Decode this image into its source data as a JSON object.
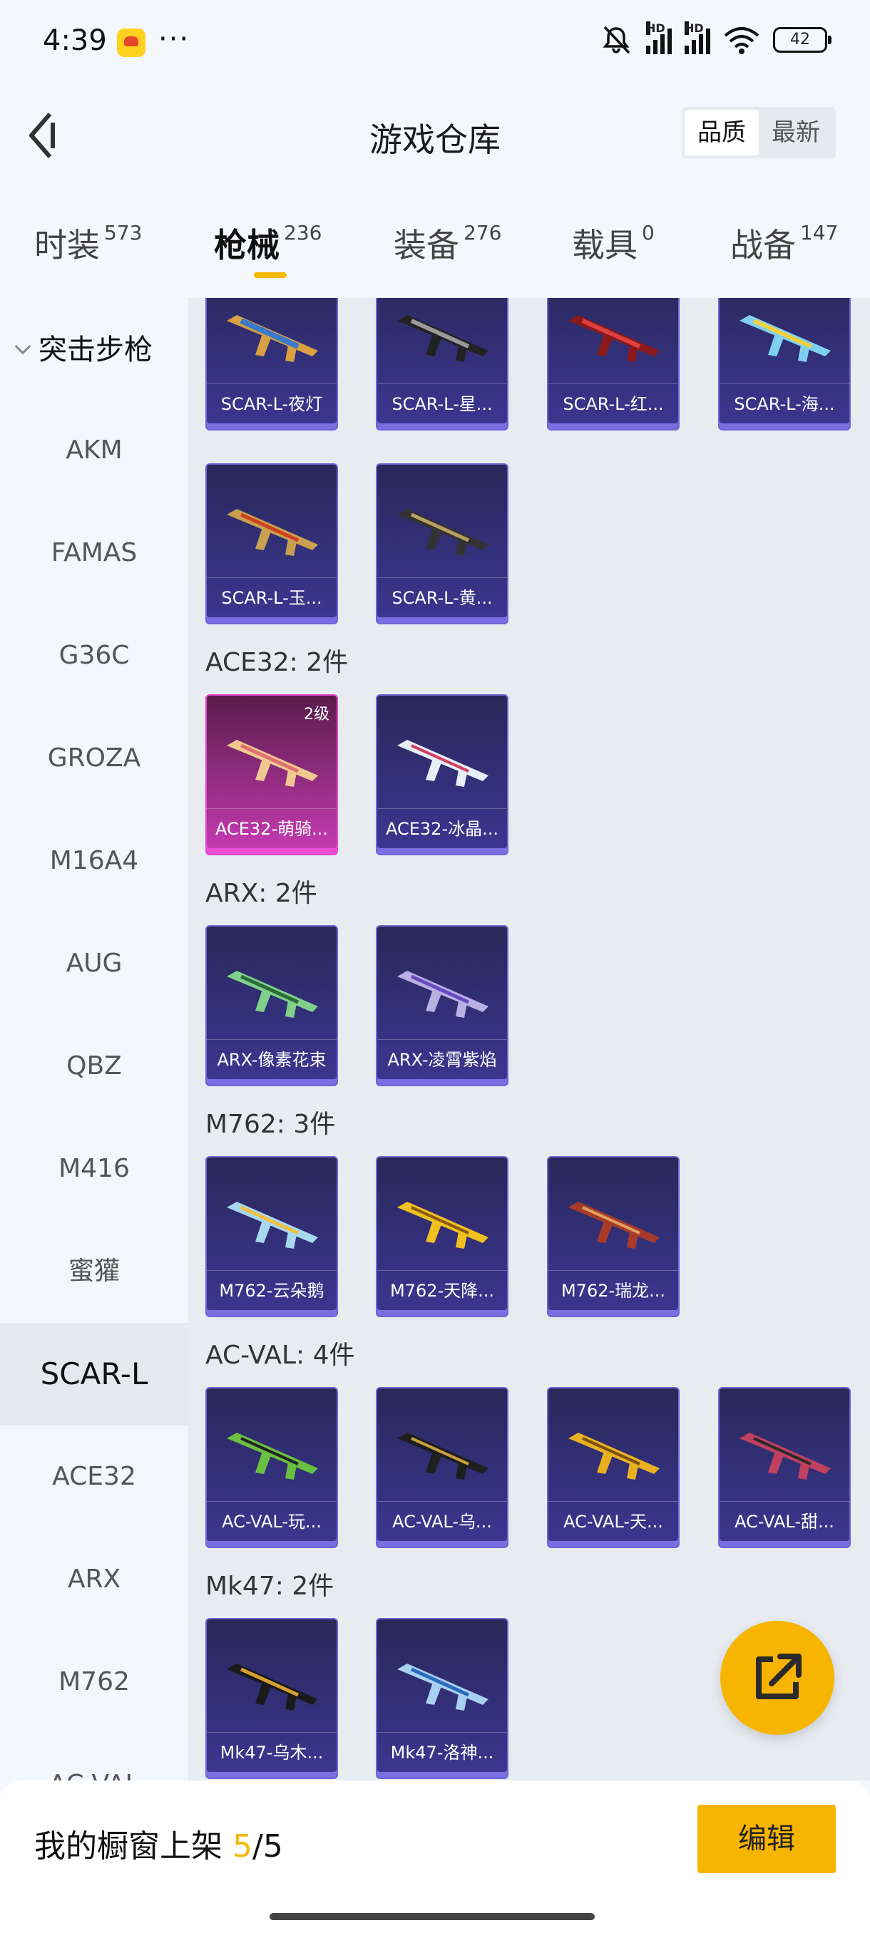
{
  "status_bar": {
    "time": "4:39",
    "dots": "···",
    "battery": "42",
    "signal_1": "HD",
    "signal_2": "HD"
  },
  "header": {
    "title": "游戏仓库",
    "sort_options": [
      "品质",
      "最新"
    ],
    "active_sort": "品质"
  },
  "tabs": [
    {
      "label": "时装",
      "count": "573"
    },
    {
      "label": "枪械",
      "count": "236",
      "active": true
    },
    {
      "label": "装备",
      "count": "276"
    },
    {
      "label": "载具",
      "count": "0"
    },
    {
      "label": "战备",
      "count": "147"
    }
  ],
  "sidebar": {
    "group": "突击步枪",
    "items": [
      "AKM",
      "FAMAS",
      "G36C",
      "GROZA",
      "M16A4",
      "AUG",
      "QBZ",
      "M416",
      "蜜獾",
      "SCAR-L",
      "ACE32",
      "ARX",
      "M762",
      "AC-VAL"
    ],
    "active": "SCAR-L"
  },
  "sections": [
    {
      "label": "",
      "items": [
        "SCAR-L-夜灯",
        "SCAR-L-星...",
        "SCAR-L-红...",
        "SCAR-L-海...",
        "SCAR-L-玉...",
        "SCAR-L-黄..."
      ]
    },
    {
      "label": "ACE32: 2件",
      "items": [
        "ACE32-萌骑...",
        "ACE32-冰晶..."
      ],
      "level_badge": "2级"
    },
    {
      "label": "ARX: 2件",
      "items": [
        "ARX-像素花束",
        "ARX-凌霄紫焰"
      ]
    },
    {
      "label": "M762: 3件",
      "items": [
        "M762-云朵鹅",
        "M762-天降...",
        "M762-瑞龙..."
      ]
    },
    {
      "label": "AC-VAL: 4件",
      "items": [
        "AC-VAL-玩...",
        "AC-VAL-乌...",
        "AC-VAL-天...",
        "AC-VAL-甜..."
      ]
    },
    {
      "label": "Mk47: 2件",
      "items": [
        "Mk47-乌木...",
        "Mk47-洛神..."
      ]
    }
  ],
  "bottom": {
    "showcase_label": "我的橱窗上架",
    "showcase_count": "5",
    "showcase_sep": "/",
    "showcase_total": "5",
    "edit_label": "编辑"
  },
  "colors": {
    "accent": "#F7B400",
    "card_purple": "#33307A",
    "card_pink": "#C83BB6"
  }
}
